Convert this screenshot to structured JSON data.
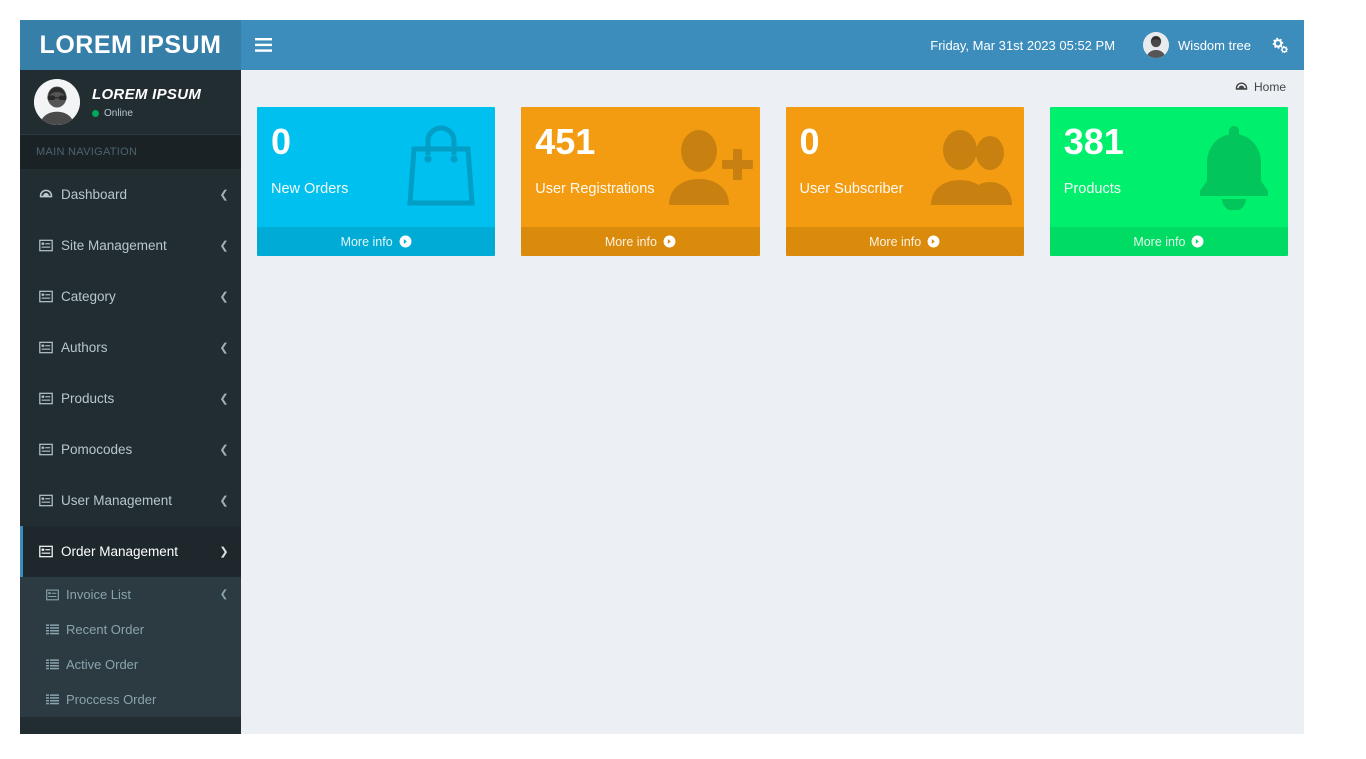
{
  "header": {
    "logo": "LOREM IPSUM",
    "toggle_icon": "hamburger-icon",
    "datetime": "Friday, Mar 31st 2023 05:52 PM",
    "user_name": "Wisdom tree",
    "settings_icon": "cogs-icon"
  },
  "sidebar": {
    "user_panel": {
      "name": "LOREM IPSUM",
      "status": "Online"
    },
    "nav_header": "MAIN NAVIGATION",
    "items": [
      {
        "label": "Dashboard",
        "icon": "dashboard-icon",
        "arrow": "chevron-left-icon",
        "active": false
      },
      {
        "label": "Site Management",
        "icon": "list-alt-icon",
        "arrow": "chevron-left-icon",
        "active": false
      },
      {
        "label": "Category",
        "icon": "list-alt-icon",
        "arrow": "chevron-left-icon",
        "active": false
      },
      {
        "label": "Authors",
        "icon": "list-alt-icon",
        "arrow": "chevron-left-icon",
        "active": false
      },
      {
        "label": "Products",
        "icon": "list-alt-icon",
        "arrow": "chevron-left-icon",
        "active": false
      },
      {
        "label": "Pomocodes",
        "icon": "list-alt-icon",
        "arrow": "chevron-left-icon",
        "active": false
      },
      {
        "label": "User Management",
        "icon": "list-alt-icon",
        "arrow": "chevron-left-icon",
        "active": false
      },
      {
        "label": "Order Management",
        "icon": "list-alt-icon",
        "arrow": "chevron-down-icon",
        "active": true
      }
    ],
    "submenu": [
      {
        "label": "Invoice List",
        "icon": "list-alt-icon",
        "arrow": "chevron-left-icon"
      },
      {
        "label": "Recent Order",
        "icon": "list-icon",
        "arrow": ""
      },
      {
        "label": "Active Order",
        "icon": "list-icon",
        "arrow": ""
      },
      {
        "label": "Proccess Order",
        "icon": "list-icon",
        "arrow": ""
      }
    ]
  },
  "content": {
    "breadcrumb": {
      "icon": "dashboard-icon",
      "label": "Home"
    },
    "boxes": [
      {
        "number": "0",
        "text": "New Orders",
        "footer": "More info",
        "icon": "shopping-bag-icon",
        "color": "#00c0ef",
        "footer_color": "#00acd6"
      },
      {
        "number": "451",
        "text": "User Registrations",
        "footer": "More info",
        "icon": "user-plus-icon",
        "color": "#f39c12",
        "footer_color": "#db8b0b"
      },
      {
        "number": "0",
        "text": "User Subscriber",
        "footer": "More info",
        "icon": "users-icon",
        "color": "#f39c12",
        "footer_color": "#db8b0b"
      },
      {
        "number": "381",
        "text": "Products",
        "footer": "More info",
        "icon": "bell-icon",
        "color": "#00ef6d",
        "footer_color": "#00db63"
      }
    ]
  }
}
